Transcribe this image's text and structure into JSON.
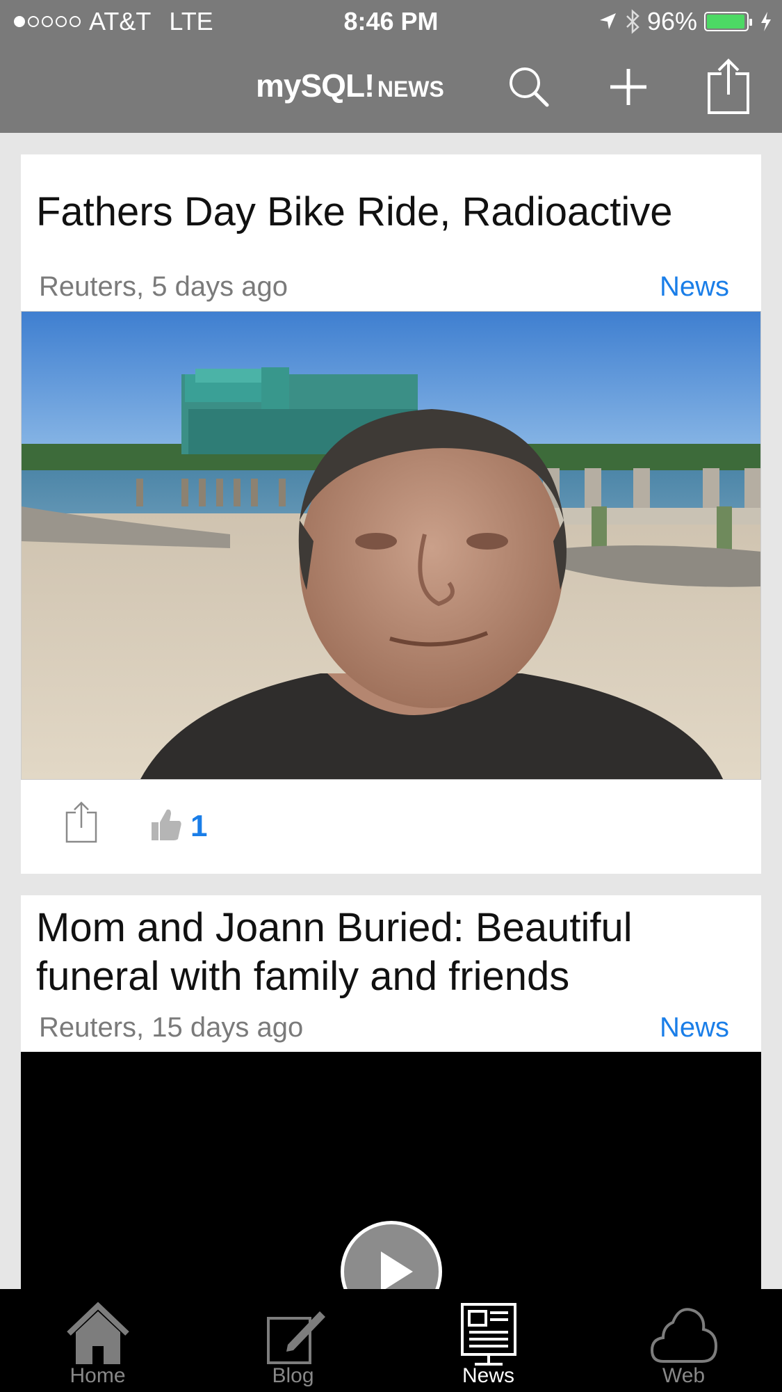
{
  "status": {
    "carrier": "AT&T",
    "network": "LTE",
    "time": "8:46 PM",
    "battery": "96%",
    "battery_level": 0.96,
    "signal_bars": 1,
    "signal_total": 5
  },
  "nav": {
    "logo_main": "mySQL!",
    "logo_sub": "NEWS",
    "icons": [
      "search-icon",
      "plus-icon",
      "share-icon"
    ]
  },
  "articles": [
    {
      "title": "Fathers Day Bike Ride, Radioactive",
      "source": "Reuters, 5 days ago",
      "category": "News",
      "likes": "1"
    },
    {
      "title": "Mom and Joann Buried: Beautiful funeral with family and friends",
      "source": "Reuters, 15 days ago",
      "category": "News"
    }
  ],
  "tabs": [
    {
      "label": "Home",
      "icon": "home-icon"
    },
    {
      "label": "Blog",
      "icon": "blog-edit-icon"
    },
    {
      "label": "News",
      "icon": "newspaper-icon",
      "active": true
    },
    {
      "label": "Web",
      "icon": "cloud-icon"
    }
  ],
  "colors": {
    "nav_bg": "#7a7a7a",
    "accent": "#1a7ee8",
    "battery": "#4cd964"
  }
}
